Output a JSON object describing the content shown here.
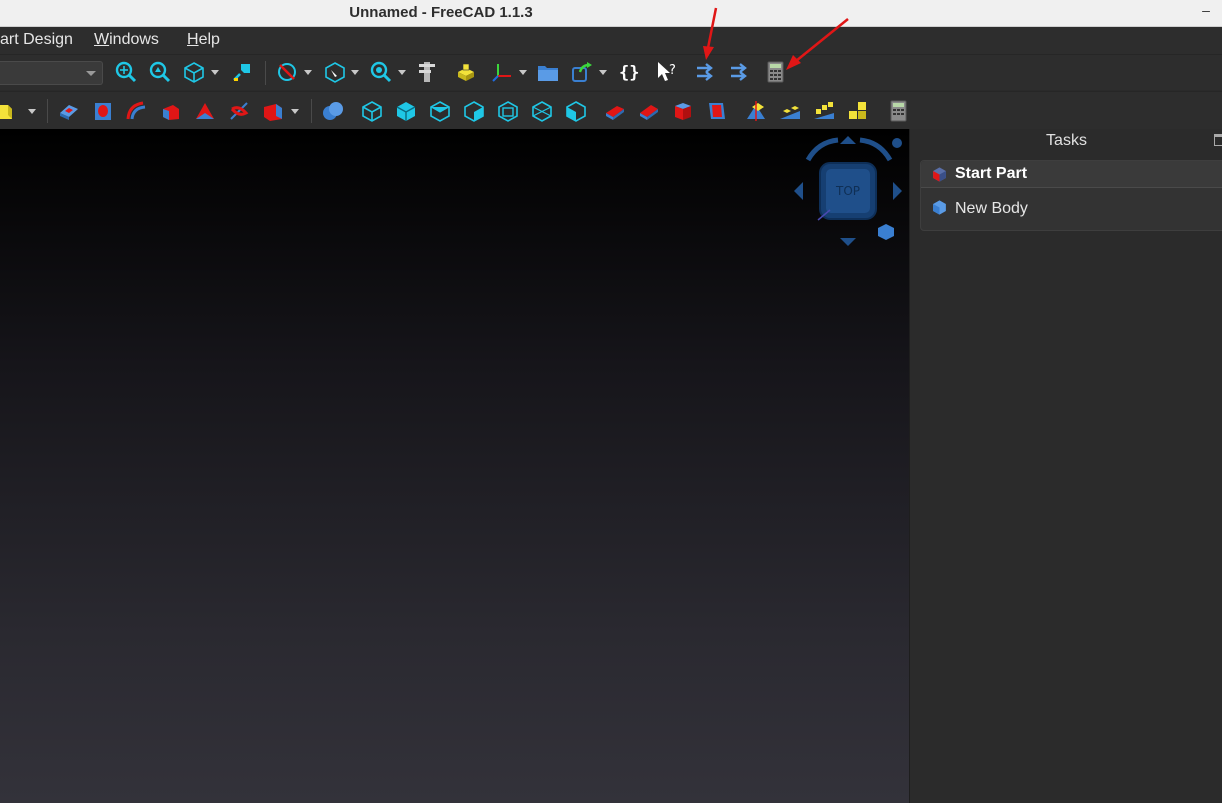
{
  "window": {
    "title": "Unnamed - FreeCAD 1.1.3",
    "minimize_glyph": "–"
  },
  "menubar": {
    "items": [
      {
        "label": "art Design",
        "underline": ""
      },
      {
        "prefix": "",
        "underline": "W",
        "rest": "indows"
      },
      {
        "prefix": "",
        "underline": "H",
        "rest": "elp"
      }
    ]
  },
  "toolbar1": {
    "workbench_combo_value": "",
    "icons": [
      "fit-all-icon",
      "fit-selection-icon",
      "isometric-view-icon",
      "measure-icon",
      "draw-style-icon",
      "view-box-icon",
      "zoom-icon",
      "caliper-icon",
      "part-icon",
      "axis-cross-icon",
      "group-icon",
      "link-icon",
      "macro-icon",
      "whats-this-icon",
      "expressions-icon",
      "expressions-alt-icon",
      "calculator-icon"
    ]
  },
  "toolbar2": {
    "icons": [
      "part-design-body-icon",
      "pad-icon",
      "pocket-icon",
      "revolution-icon",
      "loft-icon",
      "sweep-icon",
      "helix-icon",
      "subtractive-icon",
      "boolean-icon",
      "datum-plane-icon",
      "datum-line-icon",
      "datum-point-icon",
      "shape-binder-icon",
      "clone-icon",
      "sub-shape-binder-icon",
      "sketch-icon",
      "fillet-icon",
      "chamfer-icon",
      "draft-icon",
      "thickness-icon",
      "mirror-icon",
      "linear-pattern-icon",
      "polar-pattern-icon",
      "multi-transform-icon",
      "spreadsheet-icon"
    ]
  },
  "navcube": {
    "face_label": "TOP"
  },
  "panel": {
    "title": "Tasks",
    "task_header": "Start Part",
    "task_item": "New Body"
  },
  "colors": {
    "accent_cyan": "#1fc7e6",
    "navcube_blue": "#1f4f8a",
    "annotation_red": "#e01616"
  }
}
